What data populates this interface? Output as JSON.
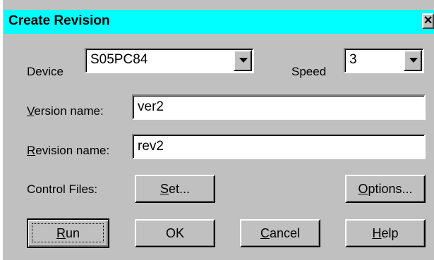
{
  "window": {
    "title": "Create Revision",
    "close_glyph": "✕"
  },
  "device": {
    "label": "Device",
    "value": "S05PC84"
  },
  "speed": {
    "label": "Speed",
    "value": "3"
  },
  "version": {
    "label_mnemonic": "V",
    "label_rest": "ersion name:",
    "value": "ver2"
  },
  "revision": {
    "label_mnemonic": "R",
    "label_rest": "evision name:",
    "value": "rev2"
  },
  "control_files": {
    "label": "Control Files:"
  },
  "buttons": {
    "set": {
      "mnemonic": "S",
      "rest": "et..."
    },
    "options": {
      "mnemonic": "O",
      "rest": "ptions..."
    },
    "run": {
      "mnemonic": "R",
      "rest": "un"
    },
    "ok": {
      "label": "OK"
    },
    "cancel": {
      "mnemonic": "C",
      "rest": "ancel"
    },
    "help": {
      "mnemonic": "H",
      "rest": "elp"
    }
  },
  "colors": {
    "title_bar": "#00ffff",
    "face": "#c0c0c0"
  }
}
